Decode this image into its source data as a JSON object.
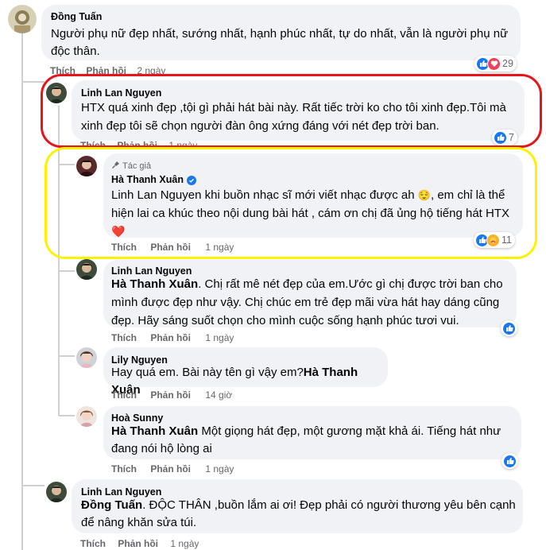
{
  "comments": [
    {
      "name": "Đồng Tuấn",
      "lines": [
        "Người phụ nữ đẹp nhất, sướng nhất, hạnh phúc nhất, tự do nhất, vẫn là người phụ nữ",
        "độc thân."
      ],
      "like": "Thích",
      "reply": "Phản hồi",
      "time": "2 ngày",
      "reactions": {
        "icons": [
          "like-icon",
          "love-icon"
        ],
        "count": "29"
      }
    },
    {
      "name": "Linh Lan Nguyen",
      "lines": [
        "HTX quá xinh đẹp ,tội gì phải hát bài này. Rất tiếc trời ko cho tôi xinh đẹp.Tôi mà",
        "xinh đẹp tôi sẽ chọn người đàn ông xứng đáng với nét đẹp trời ban."
      ],
      "like": "Thích",
      "reply": "Phản hồi",
      "time": "1 ngày",
      "reactions": {
        "icons": [
          "like-icon"
        ],
        "count": "7"
      }
    },
    {
      "author_tag": "Tác giả",
      "name": "Hà Thanh Xuân",
      "mention": "Linh Lan Nguyen",
      "line1_rest": " khi buồn nhạc sĩ mới viết nhạc được ah ",
      "emoji1": "😌",
      "line1_tail": ", em chỉ là thể",
      "line2": "hiện lai ca khúc theo nội dung bài hát , cám ơn chị đã ủng hộ tiếng hát HTX",
      "emoji2": "❤️",
      "like": "Thích",
      "reply": "Phản hồi",
      "time": "1 ngày",
      "reactions": {
        "icons": [
          "like-icon",
          "care-icon"
        ],
        "count": "11"
      }
    },
    {
      "name": "Linh Lan Nguyen",
      "mention": "Hà Thanh Xuân",
      "line1_rest": ". Chị rất mê nét đẹp của em.Ước gì chị được trời ban cho",
      "line2": "mình được đẹp như vậy. Chị chúc em trẻ đẹp mãi vừa hát hay dáng cũng",
      "line3": "đẹp. Hãy sáng suốt chọn cho mình cuộc sống hạnh phúc tươi vui.",
      "like": "Thích",
      "reply": "Phản hồi",
      "time": "1 ngày",
      "reactions": {
        "icons": [
          "like-icon"
        ]
      }
    },
    {
      "name": "Lily Nguyen",
      "line1_start": "Hay quá em. Bài này tên gì vậy em?",
      "mention": "Hà Thanh Xuân",
      "like": "Thích",
      "reply": "Phản hồi",
      "time": "14 giờ"
    },
    {
      "name": "Hoà Sunny",
      "mention": "Hà Thanh Xuân",
      "line1_rest": " Một giọng hát đẹp, một gương mặt khả ái. Tiếng hát như",
      "line2": "đang nói hộ lòng ai",
      "like": "Thích",
      "reply": "Phản hồi",
      "time": "1 ngày",
      "reactions": {
        "icons": [
          "like-icon"
        ]
      }
    },
    {
      "name": "Linh Lan Nguyen",
      "mention": "Đồng Tuấn",
      "line1_rest": ". ĐỘC THÂN ,buồn lắm ai ơi! Đẹp phải có người thương yêu bên cạnh",
      "line2": "để nâng khăn sửa túi.",
      "like": "Thích",
      "reply": "Phản hồi",
      "time": "1 ngày"
    }
  ],
  "colors": {
    "like_blue": "#1877f2",
    "love_red": "#f33e58",
    "highlight_red": "#e8141c",
    "highlight_yellow": "#fff200",
    "bubble_gray": "#f0f2f5"
  }
}
